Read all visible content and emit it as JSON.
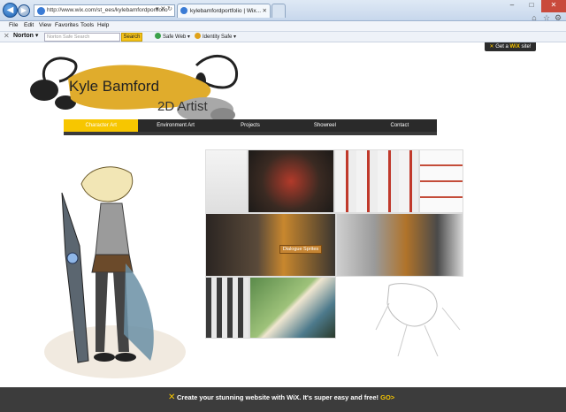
{
  "browser": {
    "back_glyph": "◀",
    "forward_glyph": "▶",
    "address_url": "http://www.wix.com/st_ees/kylebamfordportfolio",
    "address_controls": "▾ ✕ ↻",
    "tab_title": "kylebamfordportfolio | Wix...",
    "tab_close": "✕",
    "new_tab_glyph": "",
    "window_min": "–",
    "window_max": "□",
    "window_close": "✕",
    "home_glyph": "⌂",
    "star_glyph": "☆",
    "gear_glyph": "⚙"
  },
  "menu": {
    "file": "File",
    "edit": "Edit",
    "view": "View",
    "favorites": "Favorites",
    "tools": "Tools",
    "help": "Help"
  },
  "norton": {
    "close_glyph": "✕",
    "brand": "Norton ▾",
    "search_placeholder": "Norton Safe Search",
    "search_button": "Search",
    "safe_web": "Safe Web ▾",
    "identity_safe": "Identity Safe ▾"
  },
  "site": {
    "wix_badge_prefix": "Get a ",
    "wix_badge_brand": "WiX",
    "wix_badge_suffix": " site!",
    "logo_name": "Kyle Bamford",
    "logo_role": "2D Artist",
    "nav": [
      {
        "label": "Character Art",
        "active": true
      },
      {
        "label": "Environment Art",
        "active": false
      },
      {
        "label": "Projects",
        "active": false
      },
      {
        "label": "Showreel",
        "active": false
      },
      {
        "label": "Contact",
        "active": false
      }
    ],
    "gallery_caption": "Dialogue Sprites",
    "accent_color": "#f7c600"
  },
  "banner": {
    "text": "Create your stunning website with WiX. It's super easy and free!",
    "go": "GO>"
  }
}
